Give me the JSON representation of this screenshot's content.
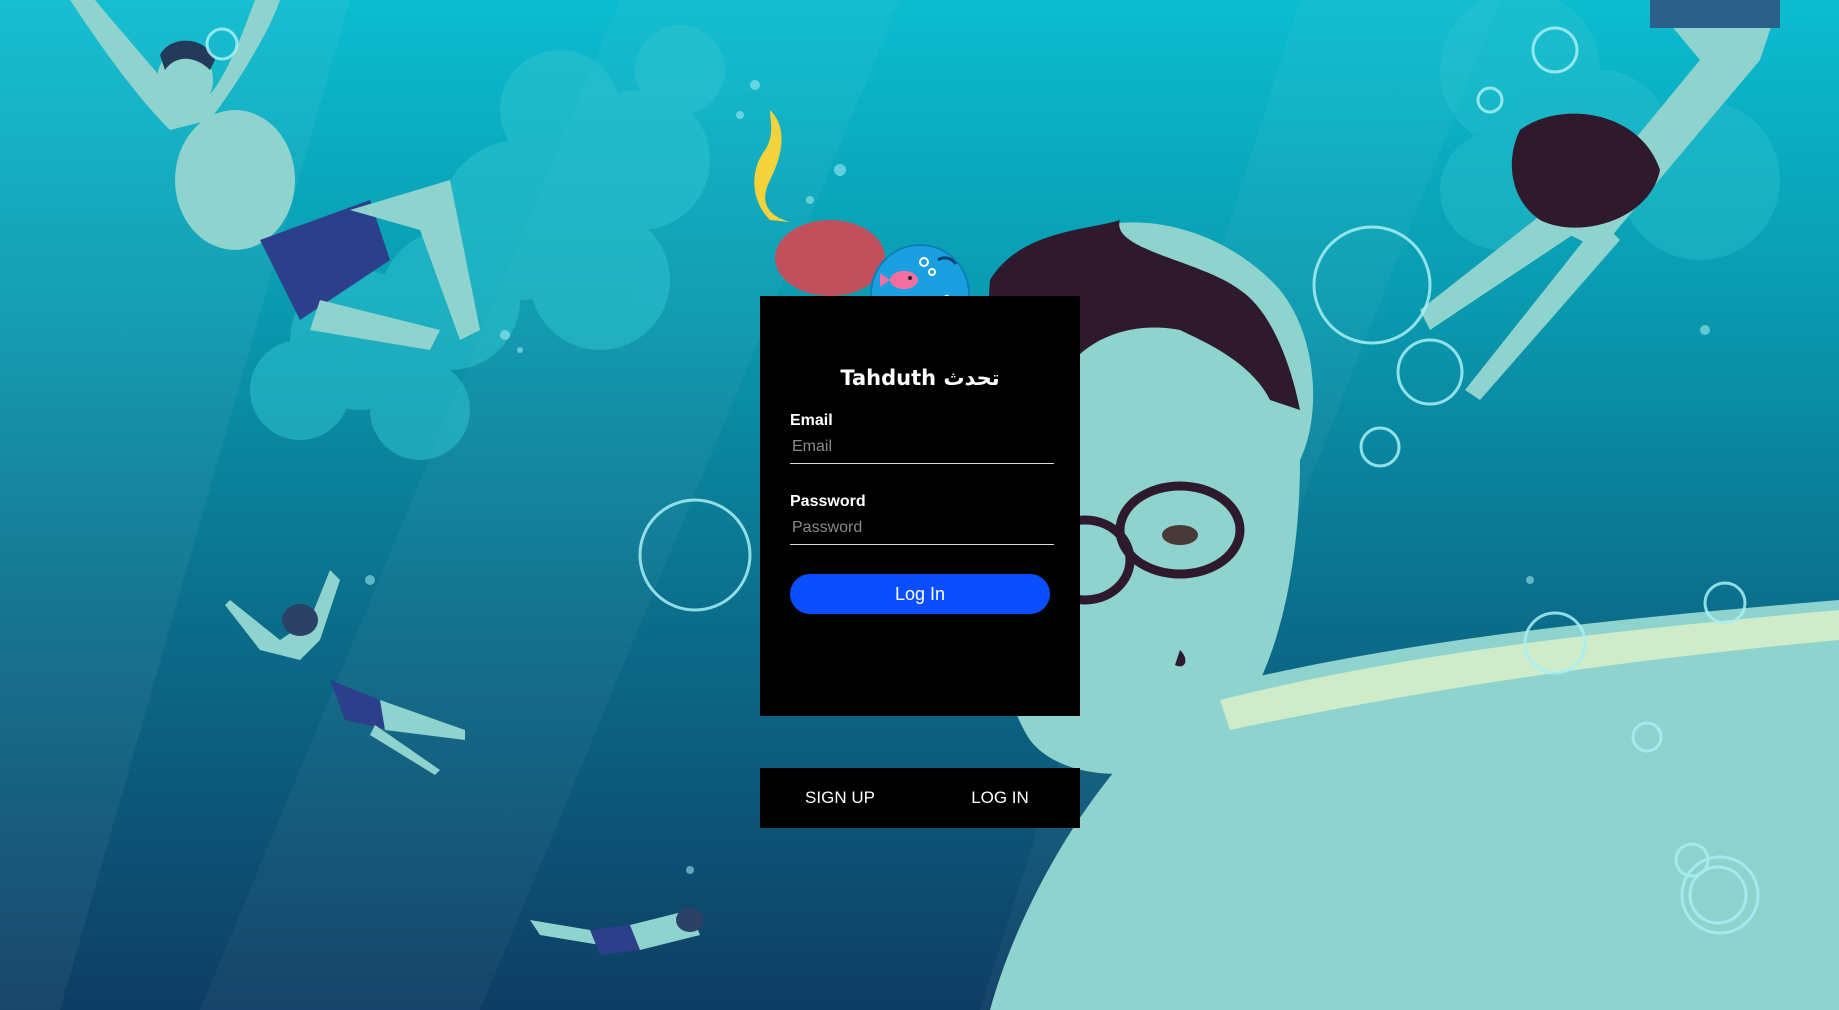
{
  "app": {
    "title": "Tahduth تحدث"
  },
  "form": {
    "email_label": "Email",
    "email_placeholder": "Email",
    "email_value": "",
    "password_label": "Password",
    "password_placeholder": "Password",
    "password_value": "",
    "submit_label": "Log In"
  },
  "nav": {
    "signup_label": "SIGN UP",
    "login_label": "LOG IN"
  },
  "colors": {
    "primary_button": "#0a4eff",
    "card_background": "#000000",
    "water_top": "#0bbccf",
    "water_bottom": "#0e3d64"
  },
  "icons": {
    "logo": "fish-aquarium-logo-icon"
  }
}
